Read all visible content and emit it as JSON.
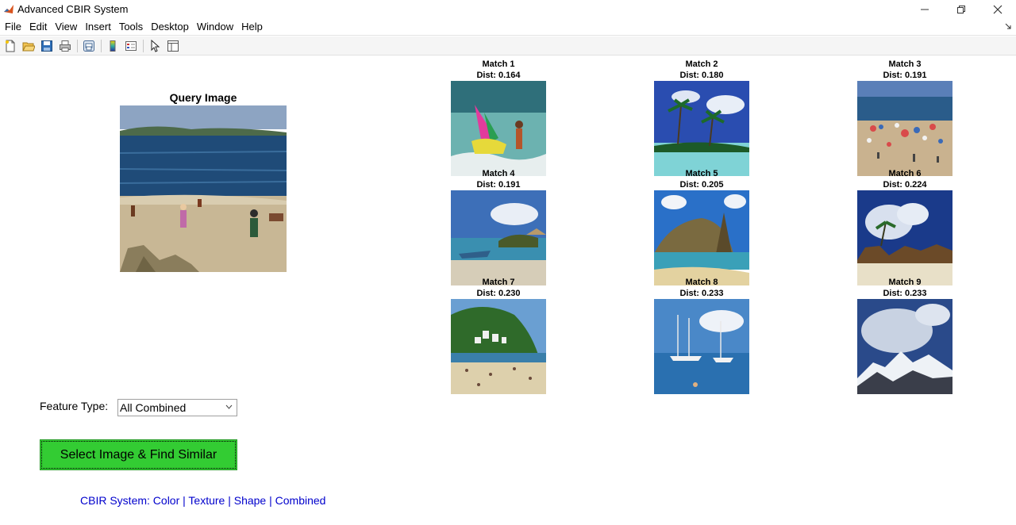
{
  "window": {
    "title": "Advanced CBIR System",
    "icon": "matlab-logo-icon",
    "controls": [
      "minimize-icon",
      "maximize-icon",
      "close-icon"
    ]
  },
  "menubar": {
    "items": [
      "File",
      "Edit",
      "View",
      "Insert",
      "Tools",
      "Desktop",
      "Window",
      "Help"
    ]
  },
  "toolbar": {
    "buttons": [
      "new-figure-icon",
      "open-file-icon",
      "save-icon",
      "print-icon",
      "print-preview-icon",
      "colorbar-icon",
      "legend-icon",
      "pointer-icon",
      "property-inspector-icon"
    ]
  },
  "query": {
    "title": "Query Image"
  },
  "matches": [
    {
      "label": "Match 1",
      "dist": "Dist: 0.164"
    },
    {
      "label": "Match 2",
      "dist": "Dist: 0.180"
    },
    {
      "label": "Match 3",
      "dist": "Dist: 0.191"
    },
    {
      "label": "Match 4",
      "dist": "Dist: 0.191"
    },
    {
      "label": "Match 5",
      "dist": "Dist: 0.205"
    },
    {
      "label": "Match 6",
      "dist": "Dist: 0.224"
    },
    {
      "label": "Match 7",
      "dist": "Dist: 0.230"
    },
    {
      "label": "Match 8",
      "dist": "Dist: 0.233"
    },
    {
      "label": "Match 9",
      "dist": "Dist: 0.233"
    }
  ],
  "controls": {
    "feature_label": "Feature Type:",
    "feature_value": "All Combined",
    "find_button": "Select Image & Find Similar"
  },
  "footer": {
    "text": "CBIR System: Color | Texture | Shape | Combined"
  },
  "colors": {
    "button_green": "#33cc33",
    "footer_blue": "#0000cc"
  }
}
